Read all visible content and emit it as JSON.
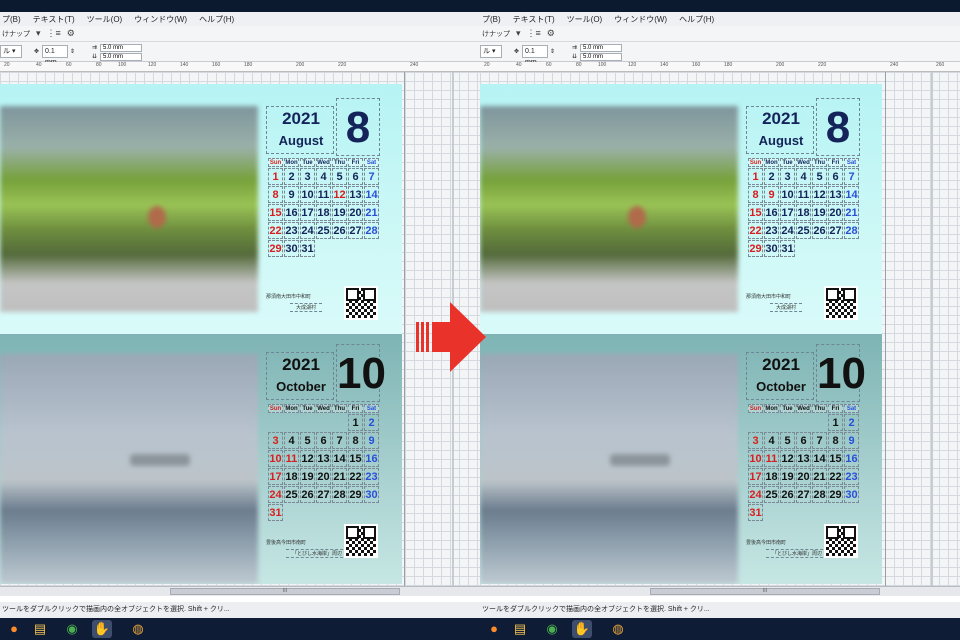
{
  "menu": {
    "left": [
      "プ(B)",
      "テキスト(T)",
      "ツール(O)",
      "ウィンドウ(W)",
      "ヘルプ(H)"
    ],
    "right": [
      "プ(B)",
      "テキスト(T)",
      "ツール(O)",
      "ウィンドウ(W)",
      "ヘルプ(H)"
    ]
  },
  "toolbar": {
    "snap_label": "けナップ",
    "nudge_value": "0.1 mm",
    "dup_x": "5.0 mm",
    "dup_y": "5.0 mm"
  },
  "ruler": {
    "left_ticks": [
      "20",
      "40",
      "60",
      "80",
      "100",
      "120",
      "140",
      "160",
      "180",
      "200",
      "220",
      "240"
    ],
    "right_ticks": [
      "20",
      "40",
      "60",
      "80",
      "100",
      "120",
      "140",
      "160",
      "180",
      "200",
      "220",
      "240",
      "260"
    ]
  },
  "calendar_top": {
    "year": "2021",
    "month_name": "August",
    "month_num": "8",
    "dow": [
      "Sun",
      "Mon",
      "Tue",
      "Wed",
      "Thu",
      "Fri",
      "Sat"
    ],
    "weeks": [
      [
        "1",
        "2",
        "3",
        "4",
        "5",
        "6",
        "7"
      ],
      [
        "8",
        "9",
        "10",
        "11",
        "12",
        "13",
        "14"
      ],
      [
        "15",
        "16",
        "17",
        "18",
        "19",
        "20",
        "21"
      ],
      [
        "22",
        "23",
        "24",
        "25",
        "26",
        "27",
        "28"
      ],
      [
        "29",
        "30",
        "31",
        "",
        "",
        "",
        ""
      ]
    ],
    "caption_a": "那須南大田市中和町",
    "caption_b": "大成湖村"
  },
  "calendar_bottom": {
    "year": "2021",
    "month_name": "October",
    "month_num": "10",
    "dow": [
      "Sun",
      "Mon",
      "Tue",
      "Wed",
      "Thu",
      "Fri",
      "Sat"
    ],
    "weeks": [
      [
        "",
        "",
        "",
        "",
        "",
        "1",
        "2"
      ],
      [
        "3",
        "4",
        "5",
        "6",
        "7",
        "8",
        "9"
      ],
      [
        "10",
        "11",
        "12",
        "13",
        "14",
        "15",
        "16"
      ],
      [
        "17",
        "18",
        "19",
        "20",
        "21",
        "22",
        "23"
      ],
      [
        "24",
        "25",
        "26",
        "27",
        "28",
        "29",
        "30"
      ],
      [
        "31",
        "",
        "",
        "",
        "",
        "",
        ""
      ]
    ],
    "caption_a": "豊後高今田市南町",
    "caption_b": "「とびし水海岸」周辺"
  },
  "status": {
    "left": "ツールをダブルクリックで描画内の全オブジェクトを選択. Shift + クリ...",
    "right": "ツールをダブルクリックで描画内の全オブジェクトを選択. Shift + クリ..."
  },
  "scroll": {
    "thumb_mark": "III"
  },
  "colors": {
    "arrow": "#e8322a",
    "sunday": "#d81e1e",
    "saturday": "#2a4fd8",
    "navy": "#14245a"
  },
  "icons": {
    "taskbar": [
      "firefox-icon",
      "file-explorer-icon",
      "chrome-icon",
      "app-icon",
      "app-icon-2"
    ]
  }
}
